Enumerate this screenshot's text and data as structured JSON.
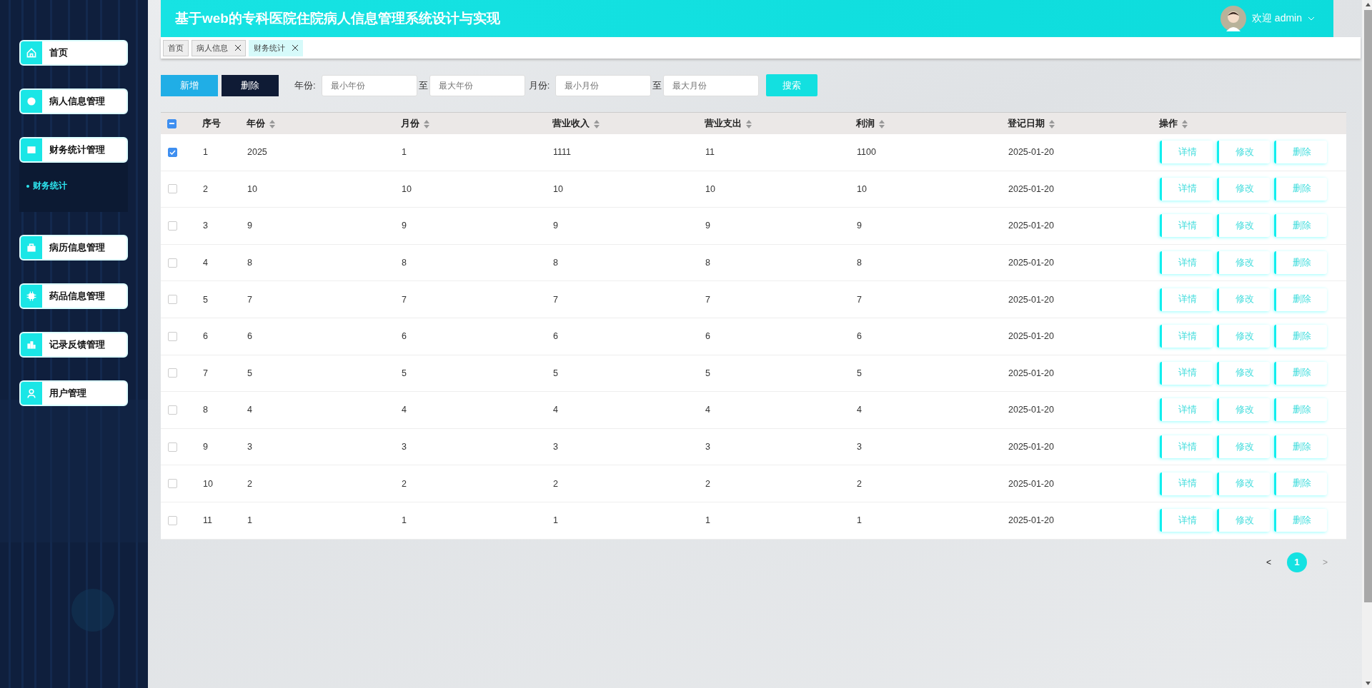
{
  "sidebar": {
    "items": [
      {
        "label": "首页",
        "expanded": false
      },
      {
        "label": "病人信息管理",
        "expanded": false
      },
      {
        "label": "财务统计管理",
        "expanded": true,
        "children": [
          {
            "label": "财务统计",
            "selected": true
          }
        ]
      },
      {
        "label": "病历信息管理",
        "expanded": false
      },
      {
        "label": "药品信息管理",
        "expanded": false
      },
      {
        "label": "记录反馈管理",
        "expanded": false
      },
      {
        "label": "用户管理",
        "expanded": false
      }
    ]
  },
  "header": {
    "title": "基于web的专科医院住院病人信息管理系统设计与实现",
    "user": "欢迎 admin"
  },
  "tabs": [
    {
      "label": "首页",
      "closable": false,
      "selected": false
    },
    {
      "label": "病人信息",
      "closable": true,
      "selected": false
    },
    {
      "label": "财务统计",
      "closable": true,
      "selected": true
    }
  ],
  "toolbar": {
    "buttons": [
      {
        "label": "新增",
        "kind": "add"
      },
      {
        "label": "删除",
        "kind": "delete"
      }
    ],
    "filters": [
      {
        "label": "年份:",
        "from_placeholder": "最小年份",
        "sep": "至",
        "to_placeholder": "最大年份"
      },
      {
        "label": "月份:",
        "from_placeholder": "最小月份",
        "sep": "至",
        "to_placeholder": "最大月份"
      }
    ],
    "search": "搜索"
  },
  "table": {
    "indeterminate": true,
    "columns": [
      "序号",
      "年份",
      "月份",
      "营业收入",
      "营业支出",
      "利润",
      "登记日期",
      "操作"
    ],
    "rows": [
      {
        "checked": true,
        "cells": [
          "1",
          "2025",
          "1",
          "1111",
          "11",
          "1100",
          "2025-01-20"
        ],
        "actions": [
          "详情",
          "修改",
          "删除"
        ]
      },
      {
        "checked": false,
        "cells": [
          "2",
          "10",
          "10",
          "10",
          "10",
          "10",
          "2025-01-20"
        ],
        "actions": [
          "详情",
          "修改",
          "删除"
        ]
      },
      {
        "checked": false,
        "cells": [
          "3",
          "9",
          "9",
          "9",
          "9",
          "9",
          "2025-01-20"
        ],
        "actions": [
          "详情",
          "修改",
          "删除"
        ]
      },
      {
        "checked": false,
        "cells": [
          "4",
          "8",
          "8",
          "8",
          "8",
          "8",
          "2025-01-20"
        ],
        "actions": [
          "详情",
          "修改",
          "删除"
        ]
      },
      {
        "checked": false,
        "cells": [
          "5",
          "7",
          "7",
          "7",
          "7",
          "7",
          "2025-01-20"
        ],
        "actions": [
          "详情",
          "修改",
          "删除"
        ]
      },
      {
        "checked": false,
        "cells": [
          "6",
          "6",
          "6",
          "6",
          "6",
          "6",
          "2025-01-20"
        ],
        "actions": [
          "详情",
          "修改",
          "删除"
        ]
      },
      {
        "checked": false,
        "cells": [
          "7",
          "5",
          "5",
          "5",
          "5",
          "5",
          "2025-01-20"
        ],
        "actions": [
          "详情",
          "修改",
          "删除"
        ]
      },
      {
        "checked": false,
        "cells": [
          "8",
          "4",
          "4",
          "4",
          "4",
          "4",
          "2025-01-20"
        ],
        "actions": [
          "详情",
          "修改",
          "删除"
        ]
      },
      {
        "checked": false,
        "cells": [
          "9",
          "3",
          "3",
          "3",
          "3",
          "3",
          "2025-01-20"
        ],
        "actions": [
          "详情",
          "修改",
          "删除"
        ]
      },
      {
        "checked": false,
        "cells": [
          "10",
          "2",
          "2",
          "2",
          "2",
          "2",
          "2025-01-20"
        ],
        "actions": [
          "详情",
          "修改",
          "删除"
        ]
      },
      {
        "checked": false,
        "cells": [
          "11",
          "1",
          "1",
          "1",
          "1",
          "1",
          "2025-01-20"
        ],
        "actions": [
          "详情",
          "修改",
          "删除"
        ]
      }
    ]
  },
  "pagination": {
    "prev": "<",
    "pages": [
      {
        "label": "1",
        "selected": true
      }
    ],
    "next": ">"
  }
}
